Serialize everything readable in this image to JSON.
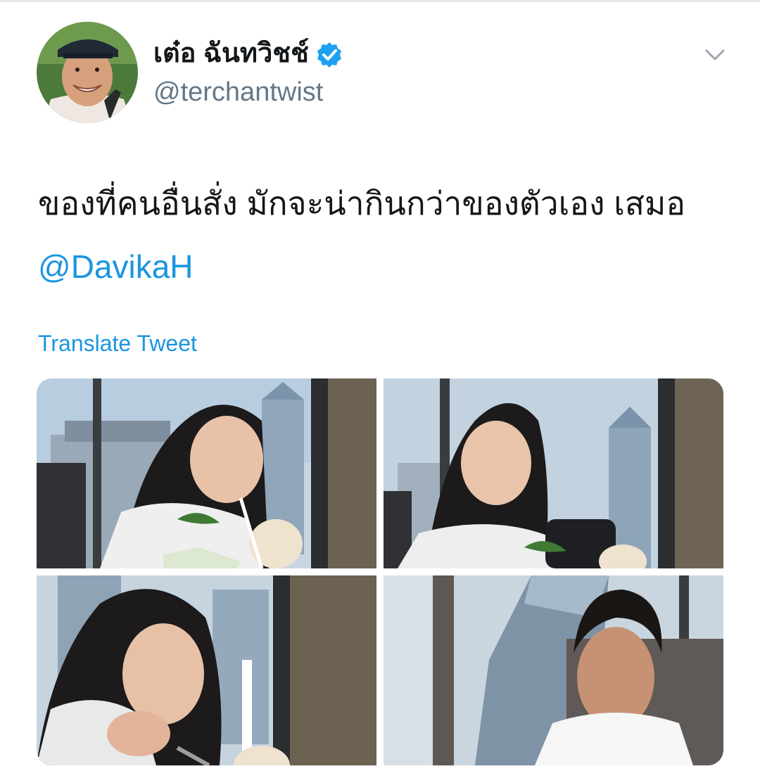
{
  "tweet": {
    "author": {
      "display_name": "เต๋อ ฉันทวิชช์",
      "handle": "@terchantwist",
      "verified": true
    },
    "text_main": "ของที่คนอื่นสั่ง มักจะน่ากินกว่าของตัวเอง เสมอ",
    "mention": "@DavikaH",
    "translate_label": "Translate Tweet",
    "photos": [
      {
        "name": "photo-1"
      },
      {
        "name": "photo-2"
      },
      {
        "name": "photo-3"
      },
      {
        "name": "photo-4"
      }
    ]
  },
  "icons": {
    "verified": "verified-badge-icon",
    "menu": "chevron-down-icon"
  },
  "colors": {
    "link": "#1b95e0",
    "text": "#14171a",
    "secondary": "#657786",
    "verified": "#1da1f2"
  }
}
